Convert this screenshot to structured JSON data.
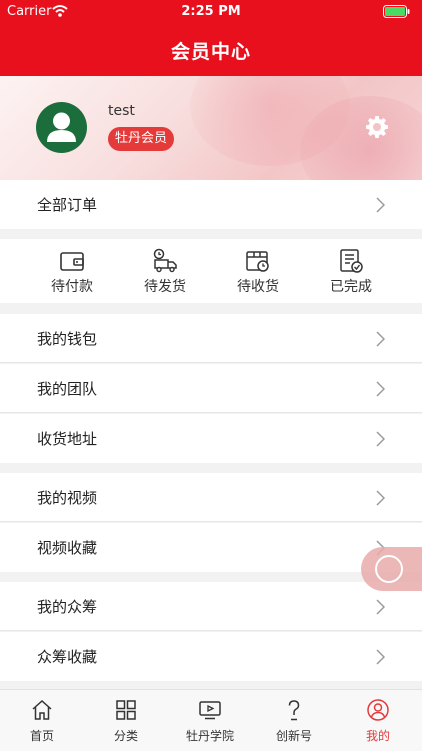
{
  "status_bar": {
    "carrier": "Carrier",
    "time": "2:25 PM"
  },
  "nav": {
    "title": "会员中心"
  },
  "profile": {
    "username": "test",
    "member_badge": "牡丹会员"
  },
  "orders": {
    "all_label": "全部订单",
    "statuses": [
      {
        "label": "待付款",
        "icon": "wallet-icon"
      },
      {
        "label": "待发货",
        "icon": "delivery-truck-icon"
      },
      {
        "label": "待收货",
        "icon": "package-clock-icon"
      },
      {
        "label": "已完成",
        "icon": "checklist-done-icon"
      }
    ]
  },
  "menu": {
    "wallet": "我的钱包",
    "team": "我的团队",
    "address": "收货地址",
    "videos": "我的视频",
    "video_favorites": "视频收藏",
    "crowdfunding": "我的众筹",
    "crowdfunding_favorites": "众筹收藏"
  },
  "tabbar": {
    "items": [
      {
        "label": "首页",
        "icon": "home-icon"
      },
      {
        "label": "分类",
        "icon": "grid-icon"
      },
      {
        "label": "牡丹学院",
        "icon": "video-play-icon"
      },
      {
        "label": "创新号",
        "icon": "question-icon"
      },
      {
        "label": "我的",
        "icon": "user-profile-icon"
      }
    ],
    "active_index": 4
  },
  "colors": {
    "brand_red": "#e8101c",
    "badge_red": "#e53a3a",
    "avatar_green": "#1b6e3b"
  }
}
